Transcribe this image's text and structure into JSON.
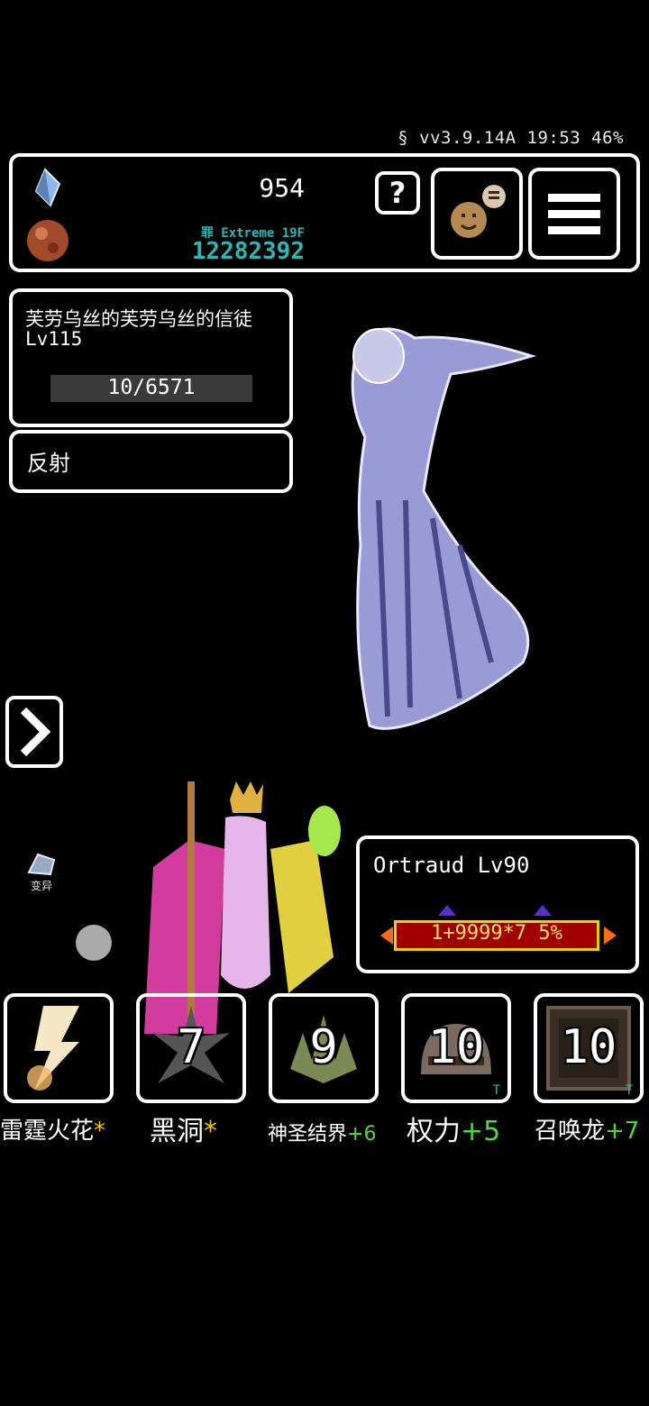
{
  "status_bar": {
    "text": "§ vv3.9.14A 19:53 46%"
  },
  "resources": {
    "gold": "954",
    "floor": "罪 Extreme 19F",
    "score": "12282392"
  },
  "header_buttons": {
    "help": "?"
  },
  "enemy": {
    "name": "芙劳乌丝的芙劳乌丝的信徒",
    "level": "Lv115",
    "hp": "10/6571"
  },
  "enemy_skill": "反射",
  "side": {
    "mutation_label": "变异"
  },
  "hero": {
    "name": "Ortraud Lv90",
    "stat": "1+9999*7 5%"
  },
  "skills": [
    {
      "count": "",
      "name": "雷霆火花",
      "suffix": "*"
    },
    {
      "count": "7",
      "name": "黑洞",
      "suffix": "*"
    },
    {
      "count": "9",
      "name": "神圣结界",
      "suffix": "+6"
    },
    {
      "count": "10",
      "name": "权力",
      "suffix": "+5",
      "tag": "T"
    },
    {
      "count": "10",
      "name": "召唤龙",
      "suffix": "+7",
      "tag": "T"
    }
  ],
  "colors": {
    "accent_teal": "#2fb6b3",
    "star_yellow": "#f5c400",
    "plus_green": "#4ddb3c",
    "hp_red": "#a00000"
  }
}
